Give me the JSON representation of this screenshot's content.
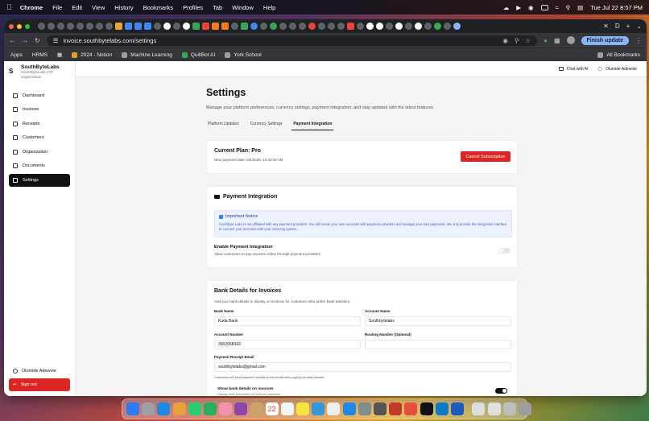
{
  "menubar": {
    "items": [
      "Chrome",
      "File",
      "Edit",
      "View",
      "History",
      "Bookmarks",
      "Profiles",
      "Tab",
      "Window",
      "Help"
    ],
    "clock": "Tue Jul 22  8:57 PM"
  },
  "browser": {
    "url": "invoice.southbytelabs.com/settings",
    "finish_update": "Finish update",
    "tab_letter": "D",
    "bookmarks": [
      "Apps",
      "HRMS",
      "2024 - Notion",
      "Machine Learning",
      "QuillBot AI",
      "York School"
    ],
    "all_bookmarks": "All Bookmarks"
  },
  "sidebar": {
    "logo": "S",
    "org_name": "SouthByteLabs",
    "org_sub": "SouthByteLabs LTD",
    "org_type": "Organization",
    "items": [
      "Dashboard",
      "Invoices",
      "Receipts",
      "Customers",
      "Organization",
      "Documents",
      "Settings"
    ],
    "user": "Olumide Adewole",
    "sign_out": "Sign out"
  },
  "topbar": {
    "chat": "Chat with AI",
    "user": "Olumide Adewole"
  },
  "settings": {
    "title": "Settings",
    "description": "Manage your platform preferences, currency settings, payment integration, and stay updated with the latest features",
    "tabs": [
      "Platform Updates",
      "Currency Settings",
      "Payment Integration"
    ],
    "active_tab": "Payment Integration"
  },
  "plan": {
    "title": "Current Plan: Pro",
    "next_payment": "Next payment date: 8/4/2025, 10:43:00 AM",
    "cancel": "Cancel Subscription"
  },
  "payment_integration": {
    "title": "Payment Integration",
    "notice_title": "Important Notice",
    "notice_body": "Southbyte Labs is not affiliated with any payment providers. You will create your own accounts with payment providers and manage your own payments. We only provide the integration interface to connect your accounts with your invoicing system.",
    "enable_title": "Enable Payment Integration",
    "enable_desc": "Allow customers to pay invoices online through payment providers",
    "enabled": false
  },
  "bank_details": {
    "title": "Bank Details for Invoices",
    "description": "Add your bank details to display on invoices for customers who prefer bank transfers.",
    "bank_name_label": "Bank Name",
    "bank_name": "Kuda Bank",
    "account_name_label": "Account Name",
    "account_name": "Southbytelabs",
    "account_number_label": "Account Number",
    "account_number": "3002658343",
    "routing_label": "Routing Number (Optional)",
    "routing": "",
    "receipt_email_label": "Payment Receipt Email",
    "receipt_email": "southbytelabs@gmail.com",
    "receipt_email_hint": "Customers will send payment receipts to this email when paying via bank transfer",
    "show_title": "Show bank details on invoices",
    "show_desc": "Display bank information for manual payments",
    "show_enabled": true
  },
  "colors": {
    "danger": "#dc2626",
    "primary": "#111111",
    "notice_bg": "#eef2ff"
  },
  "dock": {
    "calendar_day": "22"
  }
}
